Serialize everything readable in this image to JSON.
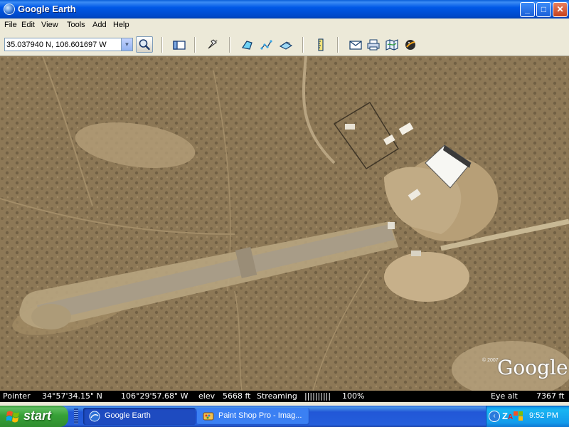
{
  "window": {
    "title": "Google Earth",
    "controls": {
      "minimize": "_",
      "maximize": "□",
      "close": "✕"
    }
  },
  "menu": [
    "File",
    "Edit",
    "View",
    "Tools",
    "Add",
    "Help"
  ],
  "toolbar": {
    "location_value": "35.037940 N, 106.601697 W",
    "tools": [
      "sidebar-toggle-icon",
      "add-placemark-icon",
      "add-polygon-icon",
      "add-path-icon",
      "add-image-overlay-icon",
      "ruler-icon",
      "email-icon",
      "print-icon",
      "view-in-maps-icon",
      "sky-icon"
    ]
  },
  "map": {
    "logo": "Google",
    "copyright": "© 2007"
  },
  "status": {
    "pointer_label": "Pointer",
    "latitude": "34°57'34.15\" N",
    "longitude": "106°29'57.68\" W",
    "elev_label": "elev",
    "elev_value": "5668 ft",
    "streaming_label": "Streaming",
    "streaming_bars": "||||||||||",
    "streaming_percent": "100%",
    "eye_alt_label": "Eye alt",
    "eye_alt_value": "7367 ft"
  },
  "taskbar": {
    "start_label": "start",
    "tasks": [
      {
        "label": "Google Earth",
        "active": true
      },
      {
        "label": "Paint Shop Pro - Imag...",
        "active": false
      }
    ],
    "tray_icons": [
      "show-hidden-icons-icon",
      "zonealarm-icon",
      "windows-flag-icon"
    ],
    "clock": "9:52 PM"
  },
  "colors": {
    "titlebar": "#0058e6",
    "taskbar": "#245edb",
    "start_button": "#37a137",
    "terrain": "#8f7a58",
    "runway": "#b9aa8f"
  }
}
